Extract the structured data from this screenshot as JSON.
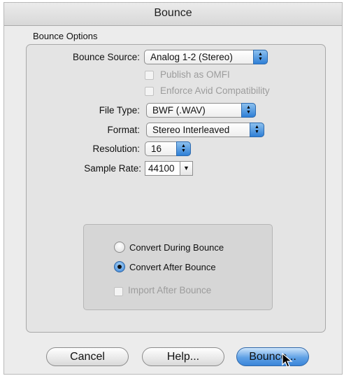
{
  "window": {
    "title": "Bounce"
  },
  "bounce_options": {
    "group_label": "Bounce Options",
    "source": {
      "label": "Bounce Source:",
      "value": "Analog 1-2 (Stereo)"
    },
    "publish_omfi": {
      "label": "Publish as OMFI",
      "checked": false,
      "enabled": false
    },
    "enforce_avid": {
      "label": "Enforce Avid Compatibility",
      "checked": false,
      "enabled": false
    },
    "file_type": {
      "label": "File Type:",
      "value": "BWF (.WAV)"
    },
    "format": {
      "label": "Format:",
      "value": "Stereo Interleaved"
    },
    "resolution": {
      "label": "Resolution:",
      "value": "16"
    },
    "sample_rate": {
      "label": "Sample Rate:",
      "value": "44100"
    },
    "convert": {
      "during": {
        "label": "Convert During Bounce",
        "selected": false
      },
      "after": {
        "label": "Convert After Bounce",
        "selected": true
      },
      "import_after": {
        "label": "Import After Bounce",
        "checked": false,
        "enabled": false
      }
    }
  },
  "buttons": {
    "cancel": "Cancel",
    "help": "Help...",
    "bounce": "Bounce..."
  },
  "colors": {
    "accent": "#3a85d9",
    "disabled_text": "#9c9c9c"
  }
}
